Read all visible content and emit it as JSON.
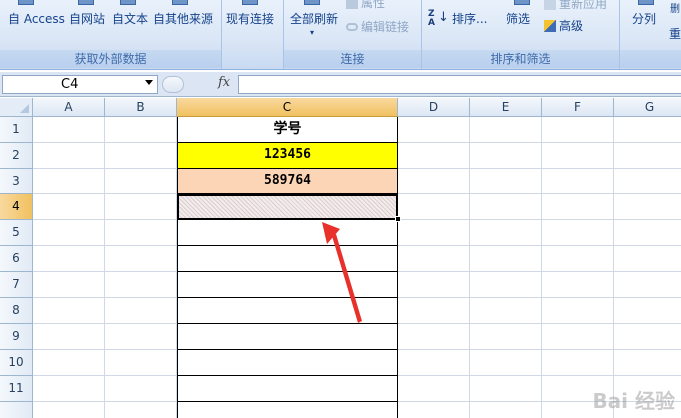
{
  "ribbon": {
    "groups": {
      "get_external_data": {
        "label": "获取外部数据",
        "buttons": [
          "自 Access",
          "自网站",
          "自文本",
          "自其他来源"
        ]
      },
      "existing_connections": {
        "label": "现有连接"
      },
      "connections": {
        "label": "连接",
        "refresh_all": "全部刷新",
        "properties": "属性",
        "edit_links": "编辑链接"
      },
      "sort_filter": {
        "label": "排序和筛选",
        "sort": "排序...",
        "filter": "筛选",
        "reapply": "重新应用",
        "advanced": "高级"
      },
      "data_tools": {
        "split": "分列",
        "partial_cut": "删",
        "partial_cut2": "重"
      }
    }
  },
  "formula_bar": {
    "name_box": "C4",
    "fx_label": "fx",
    "formula": ""
  },
  "grid": {
    "columns": [
      "A",
      "B",
      "C",
      "D",
      "E",
      "F",
      "G"
    ],
    "selected_column": "C",
    "rows": [
      "1",
      "2",
      "3",
      "4",
      "5",
      "6",
      "7",
      "8",
      "9",
      "10",
      "11"
    ],
    "selected_row": "4",
    "cells": {
      "C1": "学号",
      "C2": "123456",
      "C3": "589764",
      "C4": ""
    }
  },
  "colors": {
    "c2_fill": "#ffff00",
    "c3_fill": "#fbd5b5",
    "arrow": "#e8312a",
    "selection_header": "#f1c15f"
  },
  "watermark": "Bai 经验"
}
